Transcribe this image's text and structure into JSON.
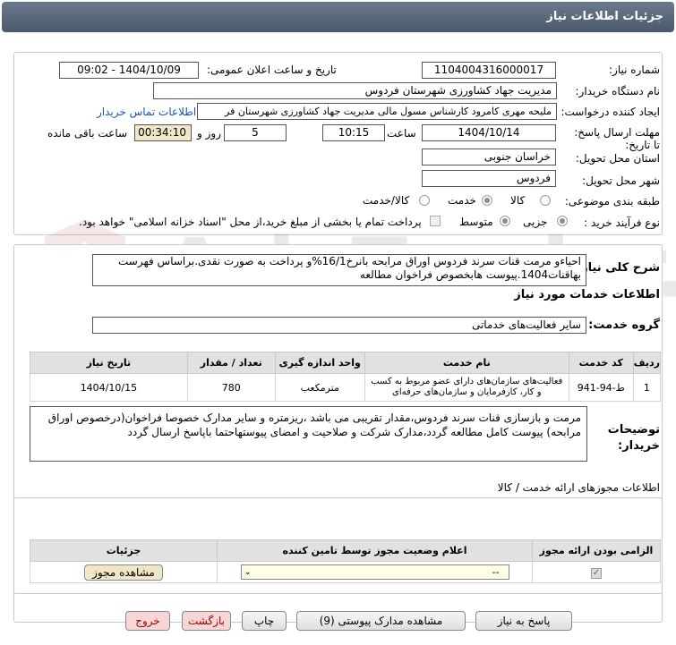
{
  "window": {
    "title": "جزئیات اطلاعات نیاز"
  },
  "form": {
    "need_number_label": "شماره نیاز:",
    "need_number": "1104004316000017",
    "announce_label": "تاریخ و ساعت اعلان عمومی:",
    "announce_value": "1404/10/09 - 09:02",
    "buyer_org_label": "نام دستگاه خریدار:",
    "buyer_org": "مدیریت جهاد کشاورزی شهرستان فردوس",
    "creator_label": "ایجاد کننده درخواست:",
    "creator": "ملیحه مهری کامرود کارشناس مسول مالی مدیریت جهاد کشاورزی شهرستان فر",
    "contact_link": "اطلاعات تماس خریدار",
    "deadline_label": "مهلت ارسال پاسخ: تا تاریخ:",
    "deadline_date": "1404/10/14",
    "time_label": "ساعت",
    "deadline_time": "10:15",
    "days_value": "5",
    "days_label": "روز و",
    "remaining_time": "00:34:10",
    "remaining_label": "ساعت باقی مانده",
    "province_label": "استان محل تحویل:",
    "province": "خراسان جنوبی",
    "city_label": "شهر محل تحویل:",
    "city": "فردوس",
    "category_label": "طبقه بندی موضوعی:",
    "category_options": [
      "کالا",
      "خدمت",
      "کالا/خدمت"
    ],
    "category_selected": "خدمت",
    "process_label": "نوع فرآیند خرید :",
    "process_options": [
      "جزیی",
      "متوسط"
    ],
    "process_selected": "جزیی",
    "payment_note": "پرداخت تمام یا بخشی از مبلغ خرید،از محل \"اسناد خزانه اسلامی\" خواهد بود."
  },
  "description": {
    "label": "شرح کلی نیاز:",
    "text": "احیاءو مرمت قنات سرند فردوس اوراق مرابحه بانرخ16/1%و پرداخت به صورت نقدی.براساس فهرست بهاقنات1404.پیوست هابخصوص فراخوان مطالعه"
  },
  "services": {
    "title": "اطلاعات خدمات مورد نیاز",
    "group_label": "گروه خدمت:",
    "group_value": "سایر فعالیت‌های خدماتی",
    "columns": [
      "ردیف",
      "کد خدمت",
      "نام خدمت",
      "واحد اندازه گیری",
      "تعداد / مقدار",
      "تاریخ نیاز"
    ],
    "rows": [
      {
        "index": "1",
        "code": "ط-94-941",
        "name": "فعالیت‌های سازمان‌های دارای عضو مربوط به کسب و کار، کارفرمایان و سازمان‌های حرفه‌ای",
        "unit": "مترمکعب",
        "qty": "780",
        "date": "1404/10/15"
      }
    ]
  },
  "buyer_notes": {
    "label": "توضیحات خریدار:",
    "text": "مرمت و بازسازی قنات سرند فردوس،مقدار تقریبی می باشد ،ریزمتره و سایر مدارک خصوصا فراخوان(درخصوص اوراق مرابحه) پیوست کامل مطالعه گردد،مدارک شرکت و صلاحیت و امضای پیوستهاحتما باپاسخ ارسال گردد"
  },
  "permits": {
    "title": "اطلاعات مجوزهای ارائه خدمت / کالا",
    "columns": [
      "الزامی بودن ارائه مجوز",
      "اعلام وضعیت مجوز توسط تامین کننده",
      "جزئیات"
    ],
    "select_value": "--",
    "view_button": "مشاهده مجوز"
  },
  "buttons": {
    "reply": "پاسخ به نیاز",
    "attachments": "مشاهده مدارک پیوستی (9)",
    "print": "چاپ",
    "back": "بازگشت",
    "exit": "خروج"
  },
  "colors": {
    "title_bar": "#5a6a7c",
    "link": "#1a55b5",
    "tan_field": "#f2e6c8",
    "exit_button": "#f6d6d6"
  }
}
